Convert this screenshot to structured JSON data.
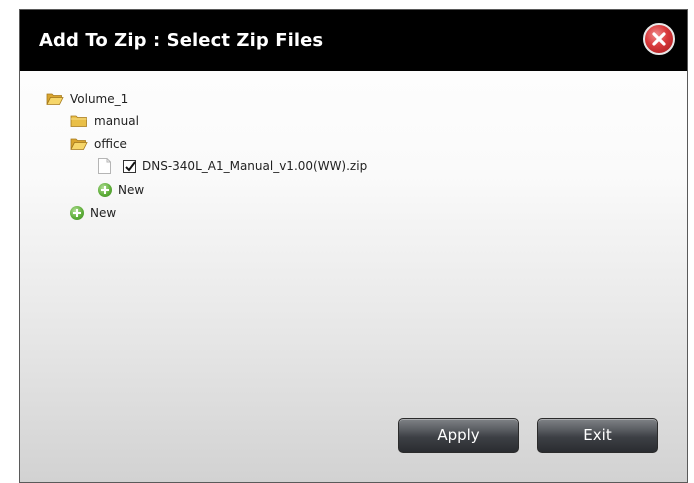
{
  "dialog": {
    "title": "Add To Zip : Select Zip Files",
    "close_icon": "close-icon"
  },
  "tree": {
    "root": {
      "label": "Volume_1",
      "icon": "folder-open-icon"
    },
    "folders": [
      {
        "label": "manual",
        "icon": "folder-closed-icon"
      },
      {
        "label": "office",
        "icon": "folder-open-icon"
      }
    ],
    "file": {
      "label": "DNS-340L_A1_Manual_v1.00(WW).zip",
      "checked": true
    },
    "new_in_office": "New",
    "new_in_root": "New"
  },
  "buttons": {
    "apply_label": "Apply",
    "exit_label": "Exit"
  },
  "colors": {
    "titlebar": "#000000",
    "close": "#d8393b",
    "add": "#5fae3a",
    "folder": "#e9b93f"
  }
}
